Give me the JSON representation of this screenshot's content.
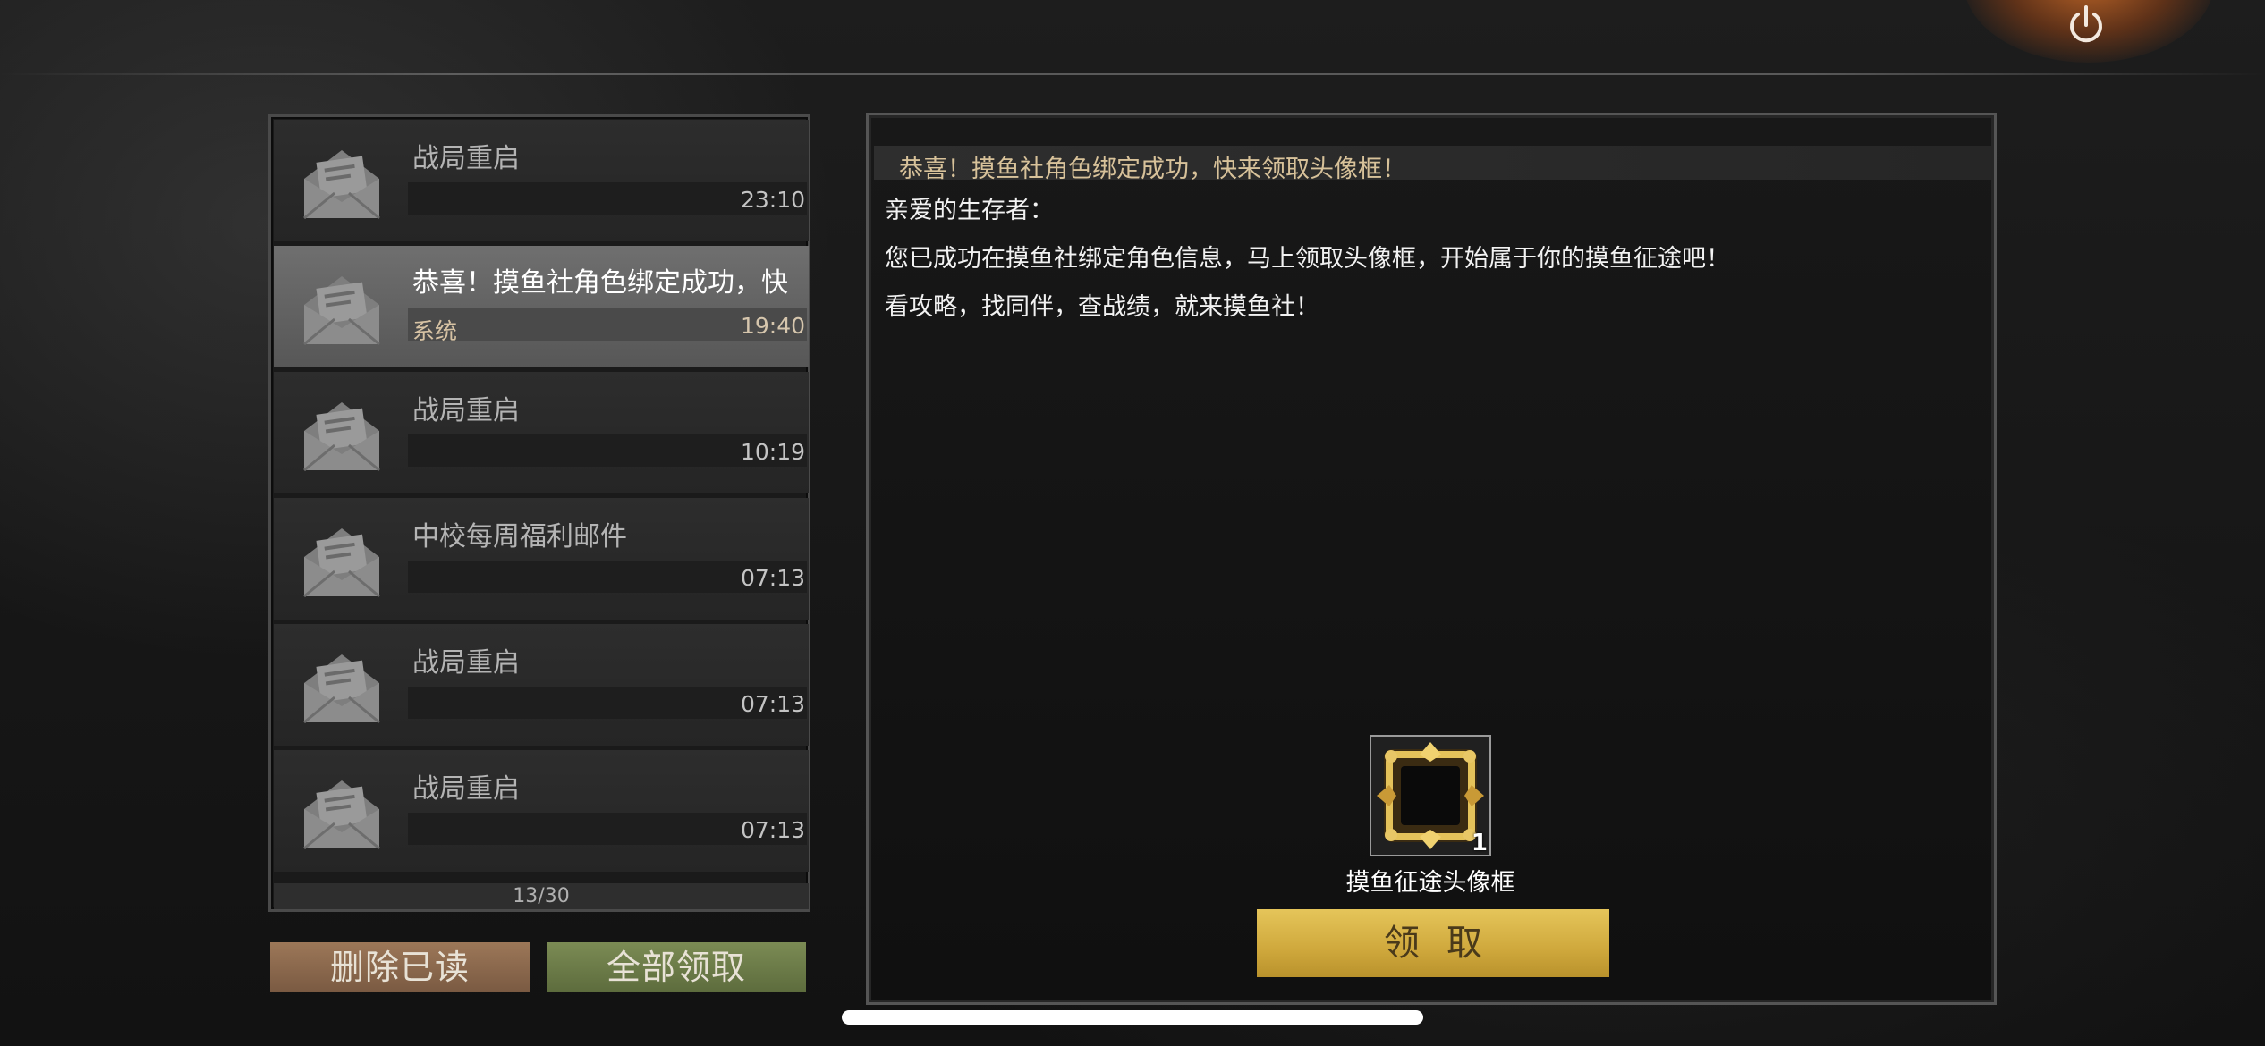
{
  "mail_list": {
    "items": [
      {
        "title": "战局重启",
        "sender": "",
        "time": "23:10",
        "selected": false
      },
      {
        "title": "恭喜！摸鱼社角色绑定成功，快",
        "sender": "系统",
        "time": "19:40",
        "selected": true
      },
      {
        "title": "战局重启",
        "sender": "",
        "time": "10:19",
        "selected": false
      },
      {
        "title": "中校每周福利邮件",
        "sender": "",
        "time": "07:13",
        "selected": false
      },
      {
        "title": "战局重启",
        "sender": "",
        "time": "07:13",
        "selected": false
      },
      {
        "title": "战局重启",
        "sender": "",
        "time": "07:13",
        "selected": false
      }
    ],
    "count_label": "13/30"
  },
  "actions": {
    "delete_read": "删除已读",
    "claim_all": "全部领取"
  },
  "mail_content": {
    "title": "恭喜！摸鱼社角色绑定成功，快来领取头像框！",
    "greeting": "亲爱的生存者：",
    "body_line1": "您已成功在摸鱼社绑定角色信息，马上领取头像框，开始属于你的摸鱼征途吧！",
    "body_line2": "看攻略，找同伴，查战绩，就来摸鱼社！",
    "reward": {
      "name": "摸鱼征途头像框",
      "count": "1"
    },
    "receive_button": "领取"
  },
  "icons": {
    "power": "power-icon",
    "mail": "open-envelope-icon",
    "reward": "avatar-frame-icon"
  },
  "colors": {
    "accent_gold": "#d9b64a",
    "delete_button": "#8c6a4e",
    "claim_all_button": "#6d7c48",
    "title_text": "#d8c29a"
  }
}
